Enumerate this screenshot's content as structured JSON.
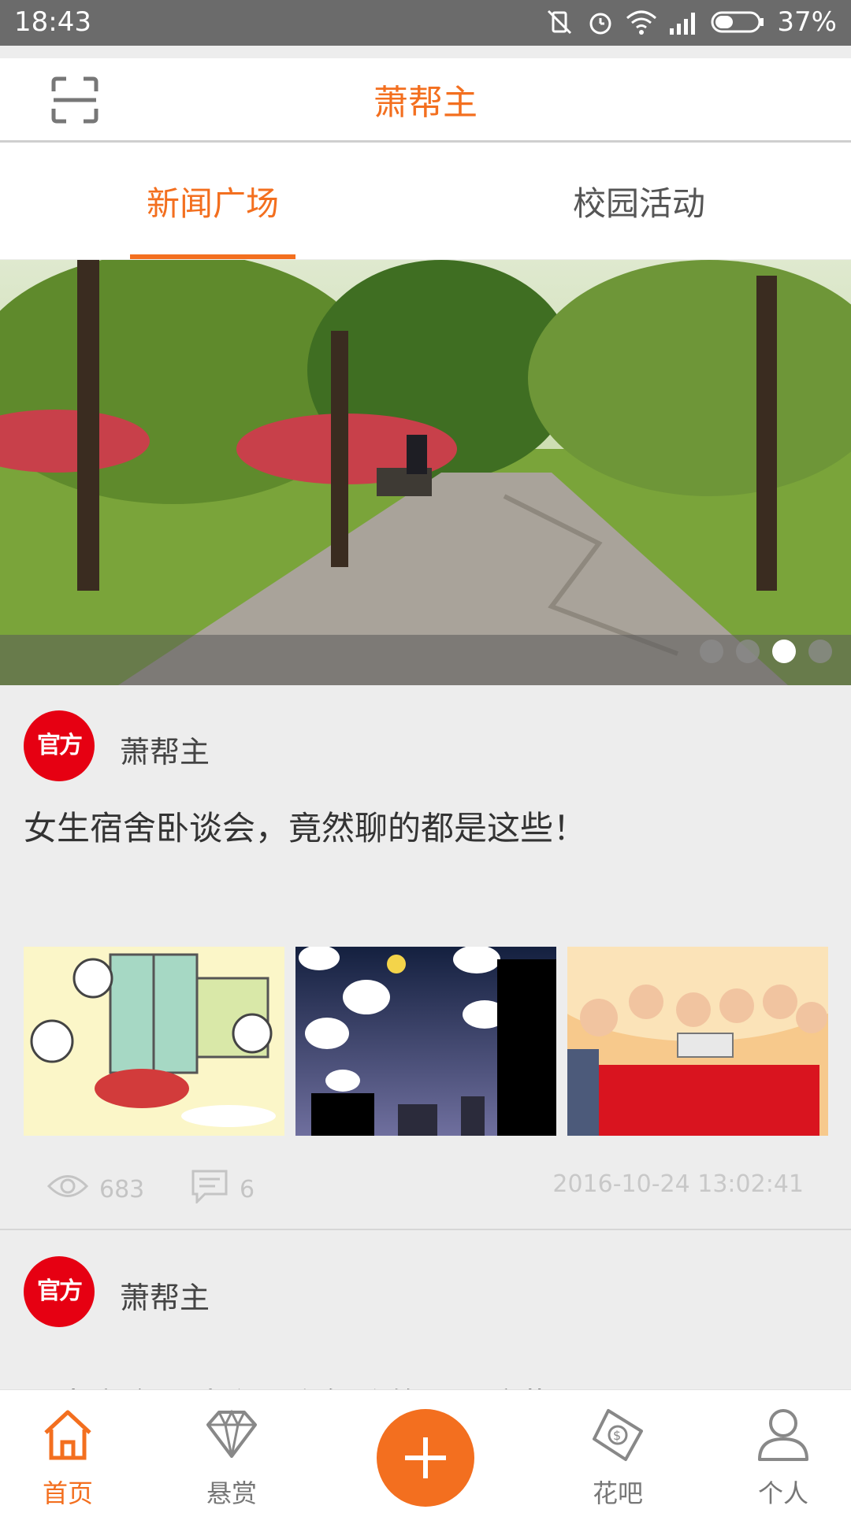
{
  "status_bar": {
    "time": "18:43",
    "battery": "37%"
  },
  "header": {
    "title": "萧帮主"
  },
  "tabs": [
    {
      "label": "新闻广场",
      "active": true
    },
    {
      "label": "校园活动",
      "active": false
    }
  ],
  "banner": {
    "page_count": 4,
    "active_index": 2
  },
  "posts": [
    {
      "badge": "官方",
      "author": "萧帮主",
      "title": "女生宿舍卧谈会，竟然聊的都是这些！",
      "views": "683",
      "comments": "6",
      "timestamp": "2016-10-24 13:02:41"
    },
    {
      "badge": "官方",
      "author": "萧帮主",
      "title": "男生宿舍卧谈会，竟然聊的都是这些！"
    }
  ],
  "bottom_nav": [
    {
      "label": "首页",
      "icon": "home-icon",
      "active": true
    },
    {
      "label": "悬赏",
      "icon": "diamond-icon",
      "active": false
    },
    {
      "label": "",
      "icon": "plus-icon",
      "active": false
    },
    {
      "label": "花吧",
      "icon": "money-tag-icon",
      "active": false
    },
    {
      "label": "个人",
      "icon": "person-icon",
      "active": false
    }
  ],
  "colors": {
    "accent": "#f36f1f",
    "badge_red": "#e60012"
  }
}
